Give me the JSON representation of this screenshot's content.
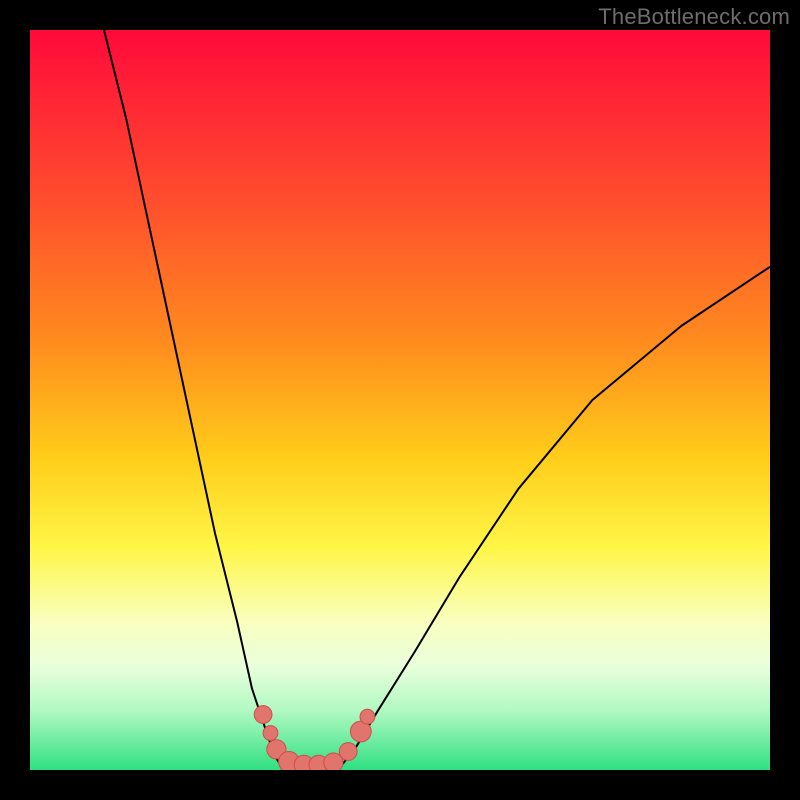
{
  "watermark": "TheBottleneck.com",
  "palette": {
    "curve_stroke": "#000000",
    "point_fill": "#e2746e",
    "point_stroke": "#d04c46",
    "frame_bg": "#000000",
    "gradient_top": "#ff0a3a",
    "gradient_bottom": "#2fe082"
  },
  "chart_data": {
    "type": "line",
    "title": "",
    "xlabel": "",
    "ylabel": "",
    "xlim": [
      0,
      100
    ],
    "ylim": [
      0,
      100
    ],
    "grid": false,
    "legend": false,
    "series": [
      {
        "name": "left-branch",
        "x": [
          10,
          13,
          16,
          19,
          22,
          25,
          28,
          30,
          32,
          33,
          34
        ],
        "y": [
          100,
          88,
          74,
          60,
          46,
          32,
          20,
          11,
          5,
          2,
          0.5
        ]
      },
      {
        "name": "floor",
        "x": [
          34,
          36,
          38,
          40,
          42
        ],
        "y": [
          0.5,
          0.2,
          0.2,
          0.2,
          0.5
        ]
      },
      {
        "name": "right-branch",
        "x": [
          42,
          44,
          47,
          52,
          58,
          66,
          76,
          88,
          100
        ],
        "y": [
          0.5,
          3,
          8,
          16,
          26,
          38,
          50,
          60,
          68
        ]
      }
    ],
    "highlight_points": [
      {
        "x": 31.5,
        "y": 7.5,
        "r": 1.2
      },
      {
        "x": 32.5,
        "y": 5.0,
        "r": 1.0
      },
      {
        "x": 33.3,
        "y": 2.8,
        "r": 1.3
      },
      {
        "x": 35.0,
        "y": 1.1,
        "r": 1.4
      },
      {
        "x": 37.0,
        "y": 0.7,
        "r": 1.3
      },
      {
        "x": 39.0,
        "y": 0.7,
        "r": 1.3
      },
      {
        "x": 41.0,
        "y": 1.0,
        "r": 1.3
      },
      {
        "x": 43.0,
        "y": 2.5,
        "r": 1.2
      },
      {
        "x": 44.7,
        "y": 5.2,
        "r": 1.4
      },
      {
        "x": 45.6,
        "y": 7.2,
        "r": 1.0
      }
    ],
    "annotations": []
  }
}
